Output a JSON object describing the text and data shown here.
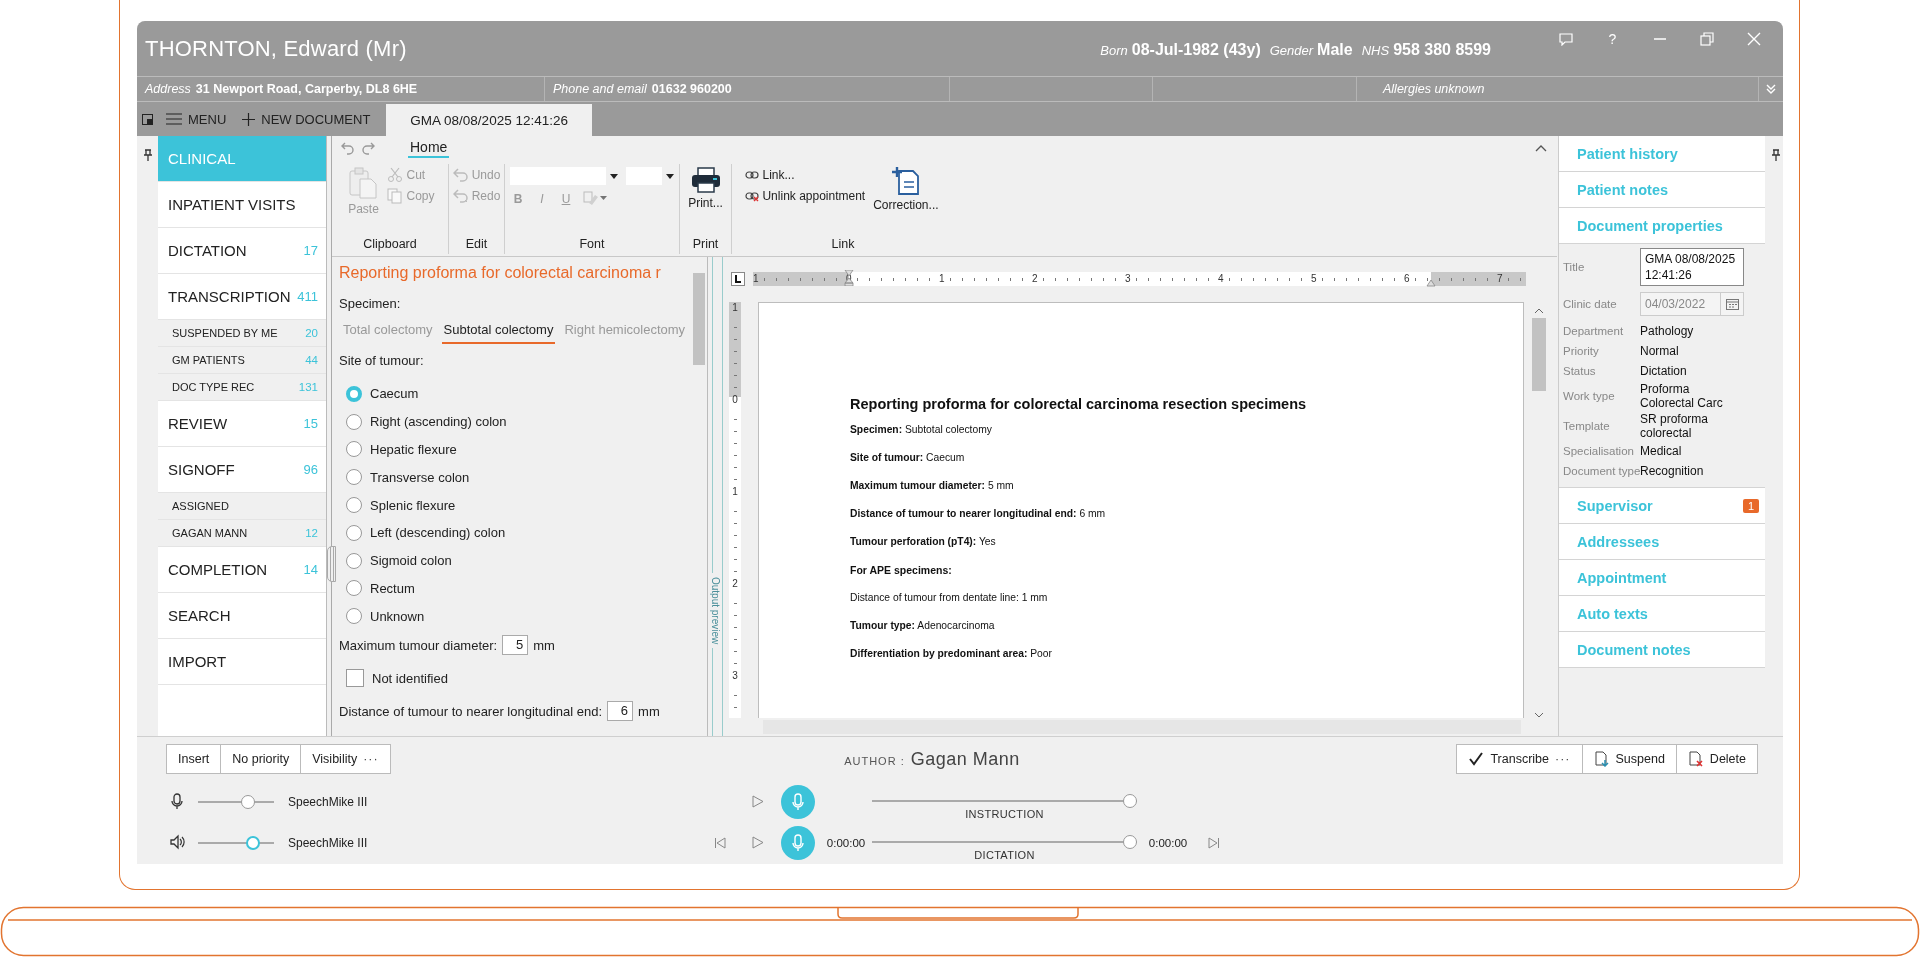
{
  "window": {
    "patient_name": "THORNTON, Edward (Mr)",
    "demographics": [
      {
        "label": "Born",
        "value": "08-Jul-1982 (43y)"
      },
      {
        "label": "Gender",
        "value": "Male"
      },
      {
        "label": "NHS",
        "value": "958 380 8599"
      }
    ],
    "help_glyph": "?"
  },
  "info_bar": [
    {
      "kind": "field",
      "label": "Address",
      "value": "31 Newport Road, Carperby, DL8 6HE"
    },
    {
      "kind": "field",
      "label": "Phone and email",
      "value": "01632 960200"
    },
    {
      "kind": "blank"
    },
    {
      "kind": "blank"
    },
    {
      "kind": "note",
      "label": "Allergies unknown"
    }
  ],
  "toolbar": {
    "menu": "MENU",
    "new_document": "NEW DOCUMENT"
  },
  "document_tabs": [
    {
      "label": "GMA 08/08/2025 12:41:26",
      "selected": true
    }
  ],
  "sidebar": {
    "items": [
      {
        "label": "CLINICAL",
        "selected": true
      },
      {
        "label": "INPATIENT VISITS",
        "selected": false
      },
      {
        "label": "DICTATION",
        "count": "17",
        "selected": false
      },
      {
        "label": "TRANSCRIPTION",
        "count": "411",
        "selected": false,
        "children": [
          {
            "label": "SUSPENDED BY ME",
            "count": "20",
            "selected": false
          },
          {
            "label": "GM PATIENTS",
            "count": "44",
            "selected": false
          },
          {
            "label": "DOC TYPE REC",
            "count": "131",
            "selected": false
          }
        ]
      },
      {
        "label": "REVIEW",
        "count": "15",
        "selected": false
      },
      {
        "label": "SIGNOFF",
        "count": "96",
        "selected": false,
        "children": [
          {
            "label": "ASSIGNED",
            "selected": false
          },
          {
            "label": "GAGAN MANN",
            "count": "12",
            "selected": false
          }
        ]
      },
      {
        "label": "COMPLETION",
        "count": "14",
        "selected": false
      },
      {
        "label": "SEARCH",
        "selected": false
      },
      {
        "label": "IMPORT",
        "selected": false
      }
    ]
  },
  "ribbon": {
    "tabs": [
      {
        "label": "Home",
        "selected": true
      }
    ],
    "groups": [
      {
        "name": "Clipboard",
        "items": [
          {
            "kind": "large",
            "label": "Paste",
            "disabled": true
          },
          {
            "kind": "small",
            "label": "Cut",
            "disabled": true
          },
          {
            "kind": "small",
            "label": "Copy",
            "disabled": true
          }
        ]
      },
      {
        "name": "Edit",
        "items": [
          {
            "kind": "small",
            "label": "Undo",
            "disabled": true
          },
          {
            "kind": "small",
            "label": "Redo",
            "disabled": true
          }
        ]
      },
      {
        "name": "Font",
        "items": [
          {
            "kind": "dropdown"
          },
          {
            "kind": "dropdown"
          },
          {
            "kind": "bold",
            "label": "B",
            "disabled": true
          },
          {
            "kind": "italic",
            "label": "I",
            "disabled": true
          },
          {
            "kind": "underline",
            "label": "U",
            "disabled": true
          },
          {
            "kind": "highlight",
            "disabled": true
          }
        ]
      },
      {
        "name": "Print",
        "items": [
          {
            "kind": "large",
            "label": "Print...",
            "disabled": false
          }
        ]
      },
      {
        "name": "Link",
        "items": [
          {
            "kind": "small",
            "label": "Link...",
            "disabled": false
          },
          {
            "kind": "small",
            "label": "Unlink appointment",
            "disabled": false
          },
          {
            "kind": "large",
            "label": "Correction...",
            "disabled": false
          }
        ]
      }
    ]
  },
  "form": {
    "title": "Reporting proforma for colorectal carcinoma r",
    "specimen": {
      "label": "Specimen:",
      "options": [
        {
          "label": "Total colectomy",
          "selected": false
        },
        {
          "label": "Subtotal colectomy",
          "selected": true
        },
        {
          "label": "Right hemicolectomy",
          "selected": false
        }
      ]
    },
    "site": {
      "label": "Site of tumour:",
      "options": [
        {
          "label": "Caecum",
          "selected": true
        },
        {
          "label": "Right (ascending) colon",
          "selected": false
        },
        {
          "label": "Hepatic flexure",
          "selected": false
        },
        {
          "label": "Transverse colon",
          "selected": false
        },
        {
          "label": "Splenic flexure",
          "selected": false
        },
        {
          "label": "Left (descending) colon",
          "selected": false
        },
        {
          "label": "Sigmoid colon",
          "selected": false
        },
        {
          "label": "Rectum",
          "selected": false
        },
        {
          "label": "Unknown",
          "selected": false
        }
      ]
    },
    "diameter": {
      "label": "Maximum tumour diameter:",
      "value": "5",
      "unit": "mm"
    },
    "not_identified": {
      "label": "Not identified",
      "checked": false
    },
    "distance": {
      "label": "Distance of tumour to nearer longitudinal end:",
      "value": "6",
      "unit": "mm"
    }
  },
  "output_preview": {
    "label": "Output preview"
  },
  "document": {
    "horizontal_ruler": [
      "1",
      "0",
      "1",
      "2",
      "3",
      "4",
      "5",
      "6",
      "7"
    ],
    "vertical_ruler": [
      "1",
      "0",
      "1",
      "2",
      "3"
    ],
    "heading": "Reporting proforma for colorectal carcinoma resection specimens",
    "lines": [
      {
        "kind": "field",
        "text": "**Specimen:** Subtotal colectomy"
      },
      {
        "kind": "field",
        "text": "**Site of tumour:** Caecum"
      },
      {
        "kind": "field",
        "text": "**Maximum tumour diameter:** 5 mm"
      },
      {
        "kind": "field",
        "text": "**Distance of tumour to nearer longitudinal end:** 6 mm"
      },
      {
        "kind": "field",
        "text": "**Tumour perforation (pT4):** Yes"
      },
      {
        "kind": "subheading",
        "text": "For APE specimens:"
      },
      {
        "kind": "plain",
        "text": "Distance of tumour from dentate line: 1 mm"
      },
      {
        "kind": "field",
        "text": "**Tumour type:** Adenocarcinoma"
      },
      {
        "kind": "field",
        "text": "**Differentiation by predominant area:** Poor"
      }
    ]
  },
  "right_panel": {
    "sections": [
      {
        "kind": "link",
        "title": "Patient history"
      },
      {
        "kind": "link",
        "title": "Patient notes"
      },
      {
        "kind": "properties",
        "title": "Document properties",
        "fields": [
          {
            "kind": "textbox",
            "label": "Title",
            "value": "GMA 08/08/2025 12:41:26"
          },
          {
            "kind": "date",
            "label": "Clinic date",
            "value": "04/03/2022"
          },
          {
            "kind": "text",
            "label": "Department",
            "value": "Pathology"
          },
          {
            "kind": "text",
            "label": "Priority",
            "value": "Normal"
          },
          {
            "kind": "text",
            "label": "Status",
            "value": "Dictation"
          },
          {
            "kind": "text",
            "label": "Work type",
            "value": "Proforma Colorectal Carc"
          },
          {
            "kind": "text",
            "label": "Template",
            "value": "SR proforma colorectal"
          },
          {
            "kind": "text",
            "label": "Specialisation",
            "value": "Medical"
          },
          {
            "kind": "text",
            "label": "Document type",
            "value": "Recognition"
          }
        ]
      },
      {
        "kind": "link",
        "title": "Supervisor",
        "badge": "1"
      },
      {
        "kind": "link",
        "title": "Addressees"
      },
      {
        "kind": "link",
        "title": "Appointment"
      },
      {
        "kind": "link",
        "title": "Auto texts"
      },
      {
        "kind": "link",
        "title": "Document notes"
      }
    ]
  },
  "bottom_bar": {
    "left_buttons": [
      {
        "label": "Insert"
      },
      {
        "label": "No priority"
      },
      {
        "label": "Visibility",
        "more": "···"
      }
    ],
    "author_label": "AUTHOR :",
    "author": "Gagan Mann",
    "right_buttons": [
      {
        "label": "Transcribe",
        "more": "···"
      },
      {
        "label": "Suspend"
      },
      {
        "label": "Delete"
      }
    ],
    "devices": [
      {
        "kind": "microphone",
        "name": "SpeechMike III",
        "level": 0.7,
        "active": false
      },
      {
        "kind": "speaker",
        "name": "SpeechMike III",
        "level": 0.77,
        "active": true
      }
    ],
    "players": [
      {
        "kind": "instruction",
        "label": "INSTRUCTION",
        "level": 1
      },
      {
        "kind": "dictation",
        "label": "DICTATION",
        "level": 1,
        "position": "0:00:00",
        "duration": "0:00:00"
      }
    ]
  }
}
